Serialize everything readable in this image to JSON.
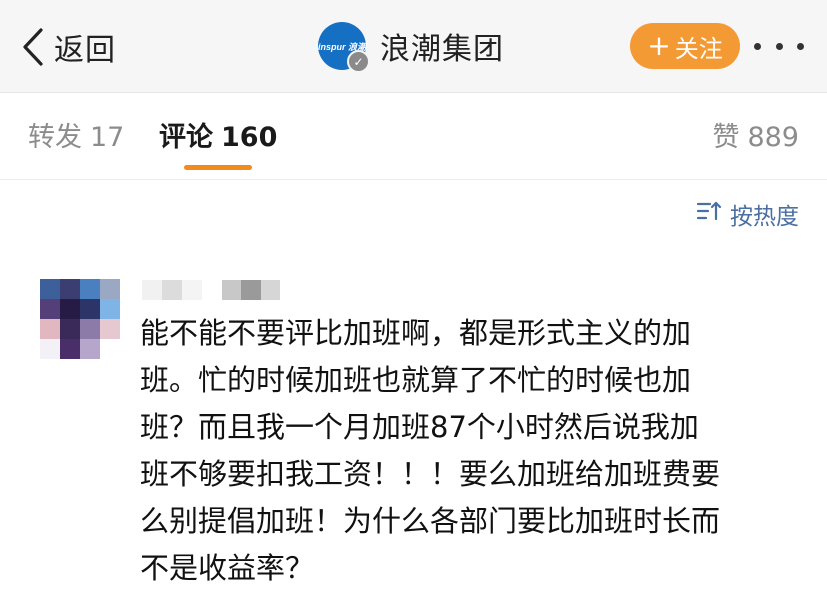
{
  "header": {
    "back_label": "返回",
    "account_name": "浪潮集团",
    "avatar_logo_text": "inspur 浪潮",
    "verified_mark": "✓",
    "follow_label": "关注",
    "follow_plus": "+",
    "colors": {
      "follow_bg": "#f49a34",
      "avatar_bg": "#1570c4",
      "tab_underline": "#f28a1e"
    }
  },
  "tabs": {
    "repost": {
      "label": "转发",
      "count": "17"
    },
    "comment": {
      "label": "评论",
      "count": "160"
    },
    "like": {
      "label": "赞",
      "count": "889"
    }
  },
  "sort": {
    "label": "按热度"
  },
  "comment": {
    "text": "能不能不要评比加班啊，都是形式主义的加\n班。忙的时候加班也就算了不忙的时候也加\n班？而且我一个月加班87个小时然后说我加\n班不够要扣我工资！！！要么加班给加班费要\n么别提倡加班！为什么各部门要比加班时长而\n不是收益率？"
  },
  "icons": {
    "back": "chevron-left-icon",
    "more": "more-dots-icon",
    "sort": "sort-list-icon",
    "verified": "verified-badge-icon"
  }
}
